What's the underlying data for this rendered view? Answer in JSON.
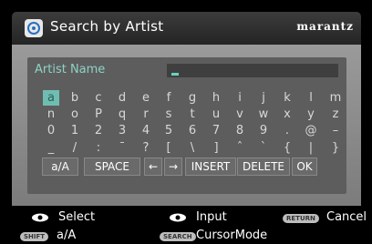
{
  "header": {
    "title": "Search by Artist",
    "brand": "marantz"
  },
  "field": {
    "label": "Artist Name"
  },
  "keyboard": {
    "rows": [
      [
        "a",
        "b",
        "c",
        "d",
        "e",
        "f",
        "g",
        "h",
        "i",
        "j",
        "k",
        "l",
        "m"
      ],
      [
        "n",
        "o",
        "P",
        "q",
        "r",
        "s",
        "t",
        "u",
        "v",
        "w",
        "x",
        "y",
        "z"
      ],
      [
        "0",
        "1",
        "2",
        "3",
        "4",
        "5",
        "6",
        "7",
        "8",
        "9",
        ".",
        "@",
        "–"
      ],
      [
        "_",
        "/",
        ":",
        "¯",
        "?",
        "[",
        "\\",
        "]",
        "ˆ",
        "`",
        "{",
        "|",
        "}"
      ]
    ],
    "buttons": [
      "a/A",
      "SPACE",
      "←",
      "→",
      "INSERT",
      "DELETE",
      "OK"
    ]
  },
  "footer": {
    "select": "Select",
    "input": "Input",
    "return_badge": "RETURN",
    "cancel": "Cancel",
    "shift_badge": "SHIFT",
    "shift_label": "a/A",
    "search_badge": "SEARCH",
    "cursor_mode": "CursorMode"
  }
}
